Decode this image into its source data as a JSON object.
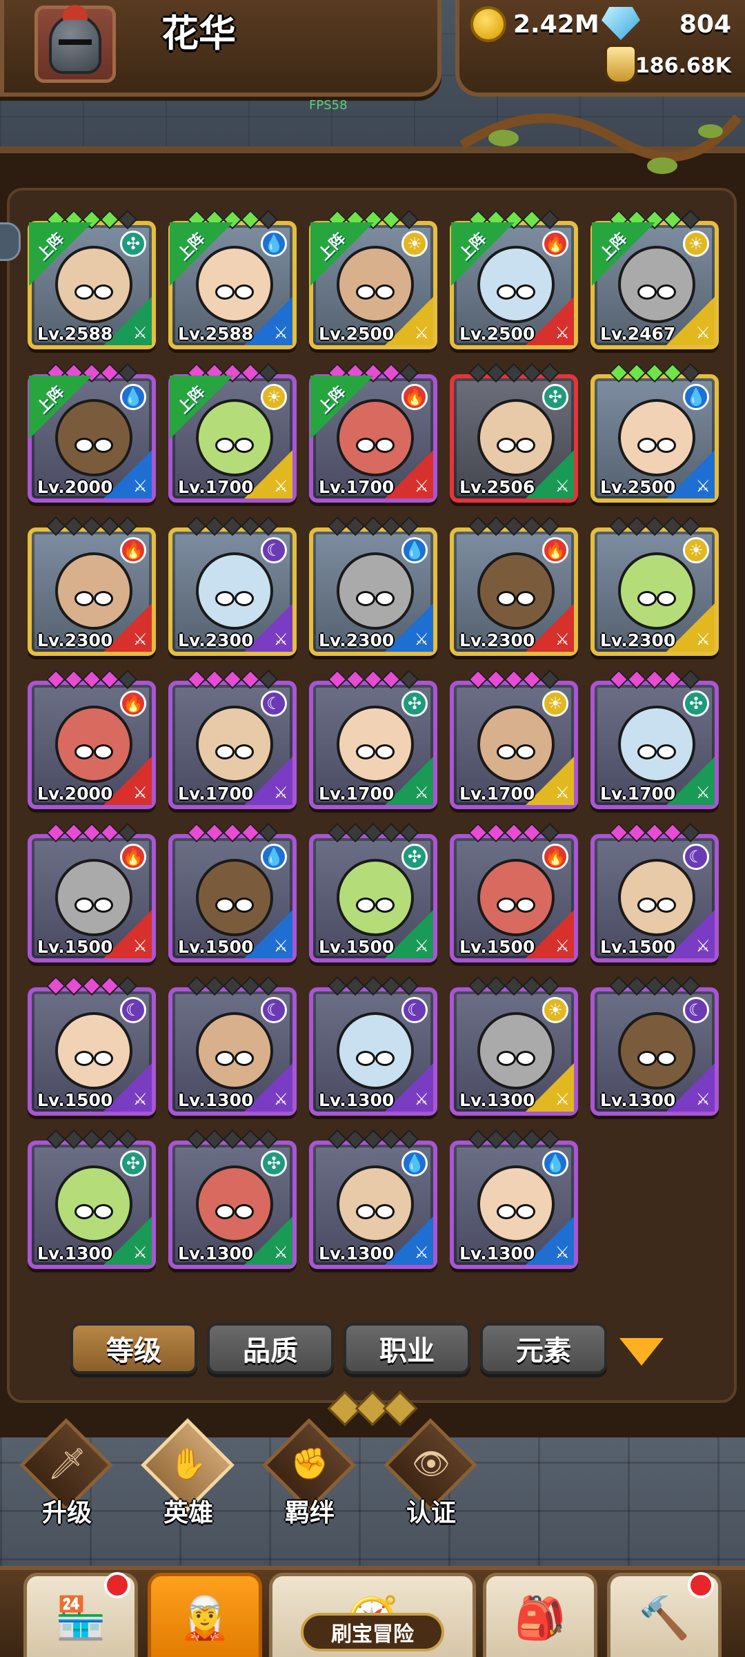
{
  "header": {
    "player_name": "花华",
    "gold": "2.42M",
    "gems": "804",
    "potion": "186.68K",
    "fps": "FPS58"
  },
  "deploy_label": "上阵",
  "heroes": [
    {
      "level": "Lv.2588",
      "frame": "gold",
      "stars": "g",
      "element": "wind",
      "deployed": true
    },
    {
      "level": "Lv.2588",
      "frame": "gold",
      "stars": "g",
      "element": "water",
      "deployed": true
    },
    {
      "level": "Lv.2500",
      "frame": "gold",
      "stars": "g",
      "element": "light",
      "deployed": true
    },
    {
      "level": "Lv.2500",
      "frame": "gold",
      "stars": "g",
      "element": "fire",
      "deployed": true
    },
    {
      "level": "Lv.2467",
      "frame": "gold",
      "stars": "g",
      "element": "light",
      "deployed": true
    },
    {
      "level": "Lv.2000",
      "frame": "purple",
      "stars": "p",
      "element": "water",
      "deployed": true
    },
    {
      "level": "Lv.1700",
      "frame": "purple",
      "stars": "p",
      "element": "light",
      "deployed": true
    },
    {
      "level": "Lv.1700",
      "frame": "purple",
      "stars": "p",
      "element": "fire",
      "deployed": true
    },
    {
      "level": "Lv.2506",
      "frame": "red",
      "stars": "none",
      "element": "wind",
      "deployed": false
    },
    {
      "level": "Lv.2500",
      "frame": "gold",
      "stars": "g",
      "element": "water",
      "deployed": false
    },
    {
      "level": "Lv.2300",
      "frame": "gold",
      "stars": "none",
      "element": "fire",
      "deployed": false
    },
    {
      "level": "Lv.2300",
      "frame": "gold",
      "stars": "none",
      "element": "dark",
      "deployed": false
    },
    {
      "level": "Lv.2300",
      "frame": "gold",
      "stars": "none",
      "element": "water",
      "deployed": false
    },
    {
      "level": "Lv.2300",
      "frame": "gold",
      "stars": "none",
      "element": "fire",
      "deployed": false
    },
    {
      "level": "Lv.2300",
      "frame": "gold",
      "stars": "none",
      "element": "light",
      "deployed": false
    },
    {
      "level": "Lv.2000",
      "frame": "purple",
      "stars": "p",
      "element": "fire",
      "deployed": false
    },
    {
      "level": "Lv.1700",
      "frame": "purple",
      "stars": "p",
      "element": "dark",
      "deployed": false
    },
    {
      "level": "Lv.1700",
      "frame": "purple",
      "stars": "p",
      "element": "wind",
      "deployed": false
    },
    {
      "level": "Lv.1700",
      "frame": "purple",
      "stars": "p",
      "element": "light",
      "deployed": false
    },
    {
      "level": "Lv.1700",
      "frame": "purple",
      "stars": "p",
      "element": "wind",
      "deployed": false
    },
    {
      "level": "Lv.1500",
      "frame": "purple",
      "stars": "p",
      "element": "fire",
      "deployed": false
    },
    {
      "level": "Lv.1500",
      "frame": "purple",
      "stars": "p",
      "element": "water",
      "deployed": false
    },
    {
      "level": "Lv.1500",
      "frame": "purple",
      "stars": "none",
      "element": "wind",
      "deployed": false
    },
    {
      "level": "Lv.1500",
      "frame": "purple",
      "stars": "p",
      "element": "fire",
      "deployed": false
    },
    {
      "level": "Lv.1500",
      "frame": "purple",
      "stars": "p",
      "element": "dark",
      "deployed": false
    },
    {
      "level": "Lv.1500",
      "frame": "purple",
      "stars": "p",
      "element": "dark",
      "deployed": false
    },
    {
      "level": "Lv.1300",
      "frame": "purple",
      "stars": "none",
      "element": "dark",
      "deployed": false
    },
    {
      "level": "Lv.1300",
      "frame": "purple",
      "stars": "none",
      "element": "dark",
      "deployed": false
    },
    {
      "level": "Lv.1300",
      "frame": "purple",
      "stars": "none",
      "element": "light",
      "deployed": false
    },
    {
      "level": "Lv.1300",
      "frame": "purple",
      "stars": "none",
      "element": "dark",
      "deployed": false
    },
    {
      "level": "Lv.1300",
      "frame": "purple",
      "stars": "none",
      "element": "wind",
      "deployed": false
    },
    {
      "level": "Lv.1300",
      "frame": "purple",
      "stars": "none",
      "element": "wind",
      "deployed": false
    },
    {
      "level": "Lv.1300",
      "frame": "purple",
      "stars": "none",
      "element": "water",
      "deployed": false
    },
    {
      "level": "Lv.1300",
      "frame": "purple",
      "stars": "none",
      "element": "water",
      "deployed": false
    }
  ],
  "sort_tabs": [
    "等级",
    "品质",
    "职业",
    "元素"
  ],
  "active_sort": 0,
  "subnav": [
    {
      "label": "升级",
      "icon": "sword-icon"
    },
    {
      "label": "英雄",
      "icon": "hero-icon"
    },
    {
      "label": "羁绊",
      "icon": "fist-icon"
    },
    {
      "label": "认证",
      "icon": "eye-icon"
    }
  ],
  "active_subnav": 1,
  "bottom_tabs": {
    "adventure_label": "刷宝冒险"
  },
  "colors": {
    "gold_frame": "#e6be3c",
    "purple_frame": "#a955d6",
    "red_frame": "#e8333a",
    "active_tab": "#ffa01e"
  }
}
